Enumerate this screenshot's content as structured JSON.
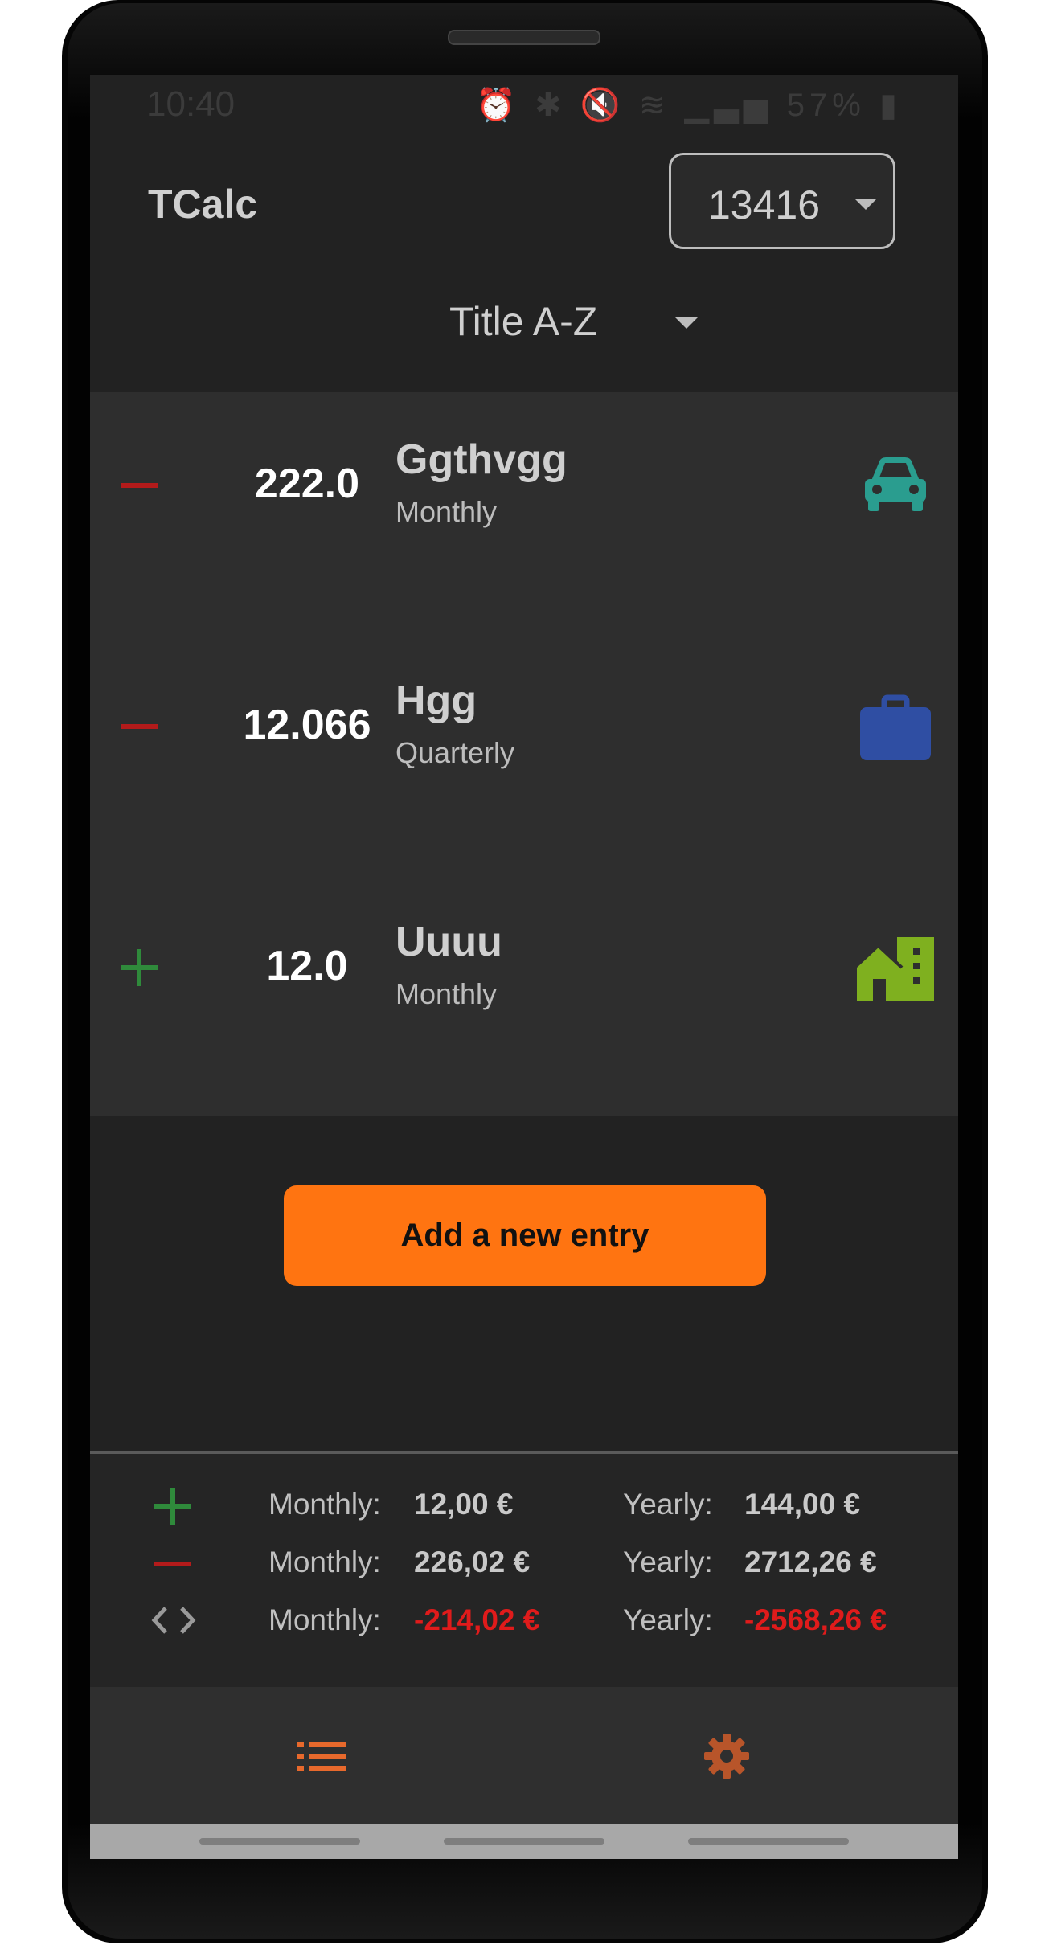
{
  "status_bar": {
    "time": "10:40",
    "battery": "57%"
  },
  "app_bar": {
    "title": "TCalc",
    "year_selector": {
      "value": "13416"
    }
  },
  "sort": {
    "label": "Title A-Z"
  },
  "entries": [
    {
      "type": "expense",
      "amount": "222.0",
      "title": "Ggthvgg",
      "frequency": "Monthly",
      "icon": "car-icon",
      "icon_color": "#2a9d8f"
    },
    {
      "type": "expense",
      "amount": "12.066",
      "title": "Hgg",
      "frequency": "Quarterly",
      "icon": "briefcase-icon",
      "icon_color": "#2f4ea3"
    },
    {
      "type": "income",
      "amount": "12.0",
      "title": "Uuuu",
      "frequency": "Monthly",
      "icon": "house-icon",
      "icon_color": "#7fb01f"
    }
  ],
  "add_button": {
    "label": "Add a new entry"
  },
  "summary": {
    "rows": [
      {
        "icon": "plus-icon",
        "monthly_label": "Monthly:",
        "monthly_value": "12,00 €",
        "yearly_label": "Yearly:",
        "yearly_value": "144,00 €"
      },
      {
        "icon": "minus-icon",
        "monthly_label": "Monthly:",
        "monthly_value": "226,02 €",
        "yearly_label": "Yearly:",
        "yearly_value": "2712,26 €"
      },
      {
        "icon": "code-brackets-icon",
        "monthly_label": "Monthly:",
        "monthly_value": "-214,02 €",
        "yearly_label": "Yearly:",
        "yearly_value": "-2568,26 €"
      }
    ]
  },
  "bottom_nav": {
    "items": [
      {
        "icon": "list-icon",
        "active": true
      },
      {
        "icon": "gear-icon",
        "active": false
      }
    ]
  },
  "colors": {
    "accent": "#ff7411",
    "income": "#2f8a3b",
    "expense": "#b31b1b",
    "negative_total": "#e01b1b"
  }
}
